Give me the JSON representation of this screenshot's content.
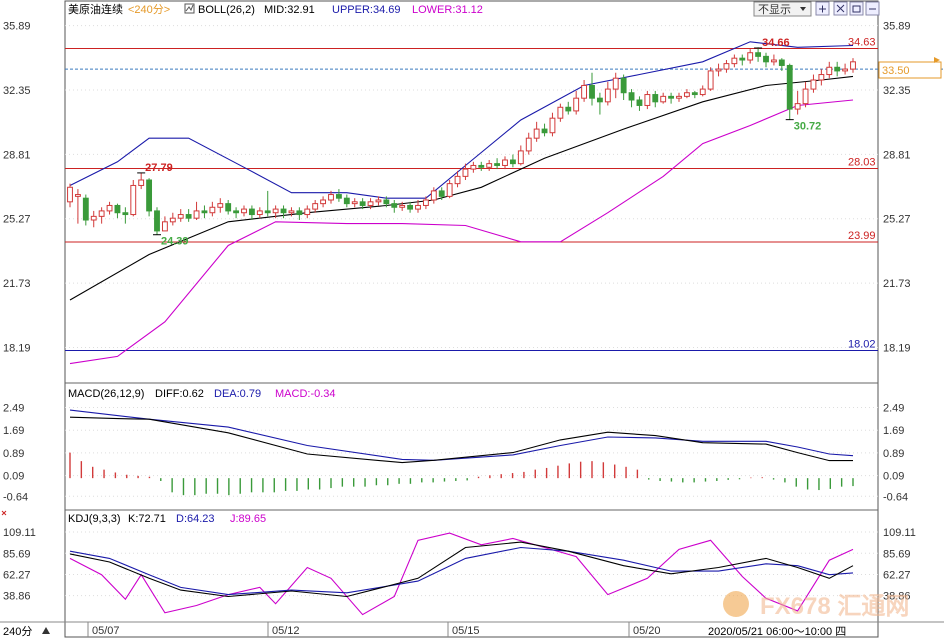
{
  "header": {
    "instrument": "美原油连续",
    "period": "<240分>",
    "indicator_name": "BOLL(26,2)",
    "mid_label": "MID:32.91",
    "upper_label": "UPPER:34.69",
    "lower_label": "LOWER:31.12",
    "display_toggle": "不显示",
    "colors": {
      "mid": "#000000",
      "upper": "#1a1aaa",
      "lower": "#cc00cc"
    }
  },
  "macd_header": {
    "name": "MACD(26,12,9)",
    "diff_label": "DIFF:0.62",
    "dea_label": "DEA:0.79",
    "macd_label": "MACD:-0.34"
  },
  "kdj_header": {
    "name": "KDJ(9,3,3)",
    "k_label": "K:72.71",
    "d_label": "D:64.23",
    "j_label": "J:89.65"
  },
  "footer": {
    "period_button": "240分",
    "date_labels": [
      "05/07",
      "05/12",
      "05/15",
      "05/20"
    ],
    "time_range": "2020/05/21 06:00～10:00 四",
    "watermark": "FX678 汇通网"
  },
  "chart_data": [
    {
      "type": "candlestick",
      "y_ticks": [
        "35.89",
        "32.35",
        "28.81",
        "25.27",
        "21.73",
        "18.19"
      ],
      "y_range": [
        16.4,
        36.2
      ],
      "price_tag": "33.50",
      "h_lines": [
        {
          "value": 34.63,
          "label": "34.63",
          "color": "#cc2222"
        },
        {
          "value": 28.03,
          "label": "28.03",
          "color": "#cc2222"
        },
        {
          "value": 23.99,
          "label": "23.99",
          "color": "#cc2222"
        },
        {
          "value": 18.02,
          "label": "18.02",
          "color": "#1a1aaa"
        }
      ],
      "annotations": [
        {
          "label": "27.79",
          "value": 27.79,
          "index": 9,
          "color": "#cc2222"
        },
        {
          "label": "24.39",
          "value": 24.39,
          "index": 11,
          "color": "#44aa44"
        },
        {
          "label": "34.66",
          "value": 34.66,
          "index": 87,
          "color": "#cc2222"
        },
        {
          "label": "30.72",
          "value": 30.72,
          "index": 91,
          "color": "#44aa44"
        }
      ],
      "candles": [
        [
          26.2,
          27.0,
          27.2,
          25.9
        ],
        [
          26.5,
          26.6,
          26.9,
          25.0
        ],
        [
          26.4,
          25.2,
          26.6,
          24.9
        ],
        [
          25.2,
          25.4,
          25.7,
          24.8
        ],
        [
          25.4,
          25.7,
          25.9,
          25.0
        ],
        [
          25.7,
          26.0,
          26.2,
          25.5
        ],
        [
          26.0,
          25.6,
          26.1,
          25.3
        ],
        [
          25.6,
          25.5,
          25.9,
          25.0
        ],
        [
          25.5,
          27.1,
          27.4,
          25.4
        ],
        [
          27.1,
          27.4,
          27.8,
          26.9
        ],
        [
          27.4,
          25.7,
          27.5,
          25.4
        ],
        [
          25.7,
          24.6,
          25.9,
          24.4
        ],
        [
          24.6,
          25.1,
          25.4,
          24.6
        ],
        [
          25.1,
          25.3,
          25.6,
          24.9
        ],
        [
          25.3,
          25.5,
          25.8,
          25.1
        ],
        [
          25.5,
          25.3,
          25.8,
          25.1
        ],
        [
          25.3,
          25.7,
          26.2,
          25.2
        ],
        [
          25.7,
          25.6,
          26.0,
          25.3
        ],
        [
          25.6,
          25.9,
          26.2,
          25.4
        ],
        [
          25.9,
          26.1,
          26.4,
          25.6
        ],
        [
          26.1,
          25.7,
          26.3,
          25.5
        ],
        [
          25.7,
          25.6,
          25.9,
          25.3
        ],
        [
          25.6,
          25.8,
          26.0,
          25.4
        ],
        [
          25.8,
          25.5,
          26.0,
          25.2
        ],
        [
          25.5,
          25.7,
          25.9,
          25.3
        ],
        [
          25.7,
          25.6,
          26.8,
          25.4
        ],
        [
          25.6,
          25.8,
          26.0,
          25.3
        ],
        [
          25.8,
          25.6,
          26.0,
          25.3
        ],
        [
          25.6,
          25.7,
          25.9,
          25.4
        ],
        [
          25.7,
          25.5,
          25.9,
          25.2
        ],
        [
          25.5,
          25.8,
          26.0,
          25.3
        ],
        [
          25.8,
          26.1,
          26.3,
          25.6
        ],
        [
          26.1,
          26.3,
          26.5,
          25.9
        ],
        [
          26.3,
          26.6,
          26.8,
          26.1
        ],
        [
          26.6,
          26.4,
          26.9,
          26.2
        ],
        [
          26.4,
          26.1,
          26.6,
          25.9
        ],
        [
          26.1,
          26.2,
          26.4,
          25.9
        ],
        [
          26.2,
          26.0,
          26.4,
          25.8
        ],
        [
          26.0,
          26.2,
          26.4,
          25.8
        ],
        [
          26.2,
          26.3,
          26.5,
          26.0
        ],
        [
          26.3,
          26.1,
          26.5,
          25.9
        ],
        [
          26.1,
          25.9,
          26.3,
          25.6
        ],
        [
          25.9,
          26.0,
          26.2,
          25.7
        ],
        [
          26.0,
          25.8,
          26.2,
          25.6
        ],
        [
          25.8,
          26.0,
          26.3,
          25.6
        ],
        [
          26.0,
          26.3,
          26.5,
          25.8
        ],
        [
          26.3,
          26.8,
          27.0,
          26.1
        ],
        [
          26.8,
          26.5,
          27.0,
          26.3
        ],
        [
          26.5,
          27.2,
          27.4,
          26.4
        ],
        [
          27.2,
          27.6,
          27.9,
          27.0
        ],
        [
          27.6,
          28.0,
          28.3,
          27.4
        ],
        [
          28.0,
          28.2,
          28.4,
          27.8
        ],
        [
          28.2,
          28.1,
          28.4,
          27.9
        ],
        [
          28.1,
          28.3,
          28.5,
          27.9
        ],
        [
          28.3,
          28.2,
          28.6,
          28.0
        ],
        [
          28.2,
          28.5,
          28.7,
          28.0
        ],
        [
          28.5,
          28.3,
          28.8,
          28.1
        ],
        [
          28.3,
          29.0,
          29.3,
          28.2
        ],
        [
          29.0,
          29.7,
          30.0,
          28.8
        ],
        [
          29.7,
          30.2,
          30.6,
          29.5
        ],
        [
          30.2,
          30.0,
          30.5,
          29.8
        ],
        [
          30.0,
          30.8,
          31.1,
          29.8
        ],
        [
          30.8,
          31.4,
          31.6,
          30.6
        ],
        [
          31.4,
          31.2,
          31.7,
          31.0
        ],
        [
          31.2,
          31.9,
          32.3,
          31.0
        ],
        [
          31.9,
          32.6,
          32.9,
          31.7
        ],
        [
          32.6,
          31.9,
          33.3,
          31.5
        ],
        [
          31.9,
          31.7,
          32.2,
          31.0
        ],
        [
          31.7,
          32.4,
          32.8,
          31.5
        ],
        [
          32.4,
          33.0,
          33.3,
          31.9
        ],
        [
          33.0,
          32.2,
          33.2,
          31.8
        ],
        [
          32.2,
          31.8,
          32.4,
          31.4
        ],
        [
          31.8,
          31.5,
          32.0,
          31.2
        ],
        [
          31.5,
          32.1,
          32.3,
          31.3
        ],
        [
          32.1,
          31.7,
          32.3,
          31.4
        ],
        [
          31.7,
          32.0,
          32.2,
          31.6
        ],
        [
          32.0,
          31.9,
          32.2,
          31.6
        ],
        [
          31.9,
          32.0,
          32.2,
          31.7
        ],
        [
          32.0,
          32.2,
          32.4,
          31.9
        ],
        [
          32.2,
          32.1,
          32.3,
          31.9
        ],
        [
          32.1,
          32.4,
          32.6,
          32.0
        ],
        [
          32.4,
          33.4,
          33.6,
          32.3
        ],
        [
          33.4,
          33.5,
          33.8,
          33.1
        ],
        [
          33.5,
          33.8,
          34.0,
          33.3
        ],
        [
          33.8,
          34.1,
          34.3,
          33.6
        ],
        [
          34.1,
          34.0,
          34.3,
          33.7
        ],
        [
          34.0,
          34.4,
          34.6,
          33.8
        ],
        [
          34.4,
          34.2,
          34.7,
          33.9
        ],
        [
          34.2,
          33.9,
          34.4,
          33.6
        ],
        [
          33.9,
          34.0,
          34.3,
          33.7
        ],
        [
          34.0,
          33.7,
          34.1,
          33.4
        ],
        [
          33.7,
          31.3,
          33.8,
          30.7
        ],
        [
          31.3,
          31.6,
          32.3,
          31.0
        ],
        [
          31.6,
          32.4,
          32.8,
          31.4
        ],
        [
          32.4,
          32.9,
          33.2,
          32.2
        ],
        [
          32.9,
          33.2,
          33.5,
          32.6
        ],
        [
          33.2,
          33.6,
          33.9,
          33.0
        ],
        [
          33.6,
          33.4,
          33.9,
          33.1
        ],
        [
          33.4,
          33.5,
          33.8,
          33.2
        ],
        [
          33.5,
          33.9,
          34.1,
          33.3
        ]
      ],
      "boll_mid": [
        [
          0,
          20.8
        ],
        [
          10,
          23.3
        ],
        [
          20,
          25.1
        ],
        [
          30,
          25.6
        ],
        [
          40,
          26.0
        ],
        [
          46,
          26.3
        ],
        [
          52,
          27.0
        ],
        [
          60,
          28.6
        ],
        [
          70,
          30.2
        ],
        [
          80,
          31.7
        ],
        [
          88,
          32.6
        ],
        [
          95,
          32.9
        ],
        [
          99,
          33.1
        ]
      ],
      "boll_upper": [
        [
          0,
          27.1
        ],
        [
          6,
          28.4
        ],
        [
          10,
          29.7
        ],
        [
          15,
          29.7
        ],
        [
          22,
          28.1
        ],
        [
          28,
          26.7
        ],
        [
          35,
          26.7
        ],
        [
          40,
          26.4
        ],
        [
          45,
          26.4
        ],
        [
          50,
          28.2
        ],
        [
          57,
          30.7
        ],
        [
          65,
          32.6
        ],
        [
          72,
          33.2
        ],
        [
          80,
          33.9
        ],
        [
          86,
          35.0
        ],
        [
          92,
          34.7
        ],
        [
          99,
          34.8
        ]
      ],
      "boll_lower": [
        [
          0,
          17.3
        ],
        [
          6,
          17.7
        ],
        [
          12,
          19.6
        ],
        [
          20,
          23.8
        ],
        [
          26,
          25.1
        ],
        [
          35,
          25.0
        ],
        [
          42,
          25.0
        ],
        [
          50,
          24.9
        ],
        [
          57,
          24.0
        ],
        [
          62,
          24.0
        ],
        [
          68,
          25.6
        ],
        [
          75,
          27.6
        ],
        [
          80,
          29.4
        ],
        [
          86,
          30.4
        ],
        [
          92,
          31.5
        ],
        [
          99,
          31.8
        ]
      ]
    },
    {
      "type": "line",
      "name": "MACD",
      "y_ticks": [
        "2.49",
        "1.69",
        "0.89",
        "0.09",
        "-0.64"
      ],
      "y_range": [
        -0.7,
        2.65
      ],
      "diff": [
        [
          0,
          2.15
        ],
        [
          6,
          2.1
        ],
        [
          10,
          2.08
        ],
        [
          20,
          1.6
        ],
        [
          30,
          0.85
        ],
        [
          42,
          0.55
        ],
        [
          46,
          0.63
        ],
        [
          56,
          0.9
        ],
        [
          62,
          1.35
        ],
        [
          68,
          1.62
        ],
        [
          74,
          1.5
        ],
        [
          80,
          1.25
        ],
        [
          88,
          1.2
        ],
        [
          92,
          0.9
        ],
        [
          96,
          0.62
        ],
        [
          99,
          0.62
        ]
      ],
      "dea": [
        [
          0,
          2.4
        ],
        [
          10,
          2.08
        ],
        [
          20,
          1.8
        ],
        [
          30,
          1.15
        ],
        [
          42,
          0.66
        ],
        [
          46,
          0.63
        ],
        [
          56,
          0.82
        ],
        [
          62,
          1.15
        ],
        [
          68,
          1.45
        ],
        [
          74,
          1.42
        ],
        [
          80,
          1.3
        ],
        [
          88,
          1.3
        ],
        [
          92,
          1.1
        ],
        [
          96,
          0.85
        ],
        [
          99,
          0.79
        ]
      ],
      "macd_bars": [
        0.9,
        0.6,
        0.4,
        0.3,
        0.2,
        0.12,
        0.08,
        0.05,
        -0.1,
        -0.5,
        -0.6,
        -0.6,
        -0.55,
        -0.55,
        -0.6,
        -0.55,
        -0.5,
        -0.5,
        -0.5,
        -0.45,
        -0.45,
        -0.4,
        -0.4,
        -0.35,
        -0.3,
        -0.3,
        -0.3,
        -0.25,
        -0.25,
        -0.2,
        -0.2,
        -0.15,
        -0.15,
        -0.12,
        -0.1,
        -0.08,
        0.05,
        0.1,
        0.14,
        0.18,
        0.22,
        0.3,
        0.36,
        0.44,
        0.52,
        0.58,
        0.6,
        0.56,
        0.48,
        0.4,
        0.3,
        -0.05,
        -0.1,
        -0.12,
        -0.15,
        -0.15,
        -0.12,
        -0.1,
        -0.06,
        -0.04,
        0.02,
        0.03,
        -0.05,
        -0.15,
        -0.3,
        -0.4,
        -0.42,
        -0.38,
        -0.3,
        -0.28
      ],
      "macd_bar_start_index": 30
    },
    {
      "type": "line",
      "name": "KDJ",
      "y_ticks": [
        "109.11",
        "85.69",
        "62.27",
        "38.86"
      ],
      "y_range": [
        12,
        118
      ],
      "k": [
        [
          0,
          85
        ],
        [
          5,
          76
        ],
        [
          10,
          58
        ],
        [
          14,
          45
        ],
        [
          20,
          38
        ],
        [
          28,
          44
        ],
        [
          35,
          38
        ],
        [
          44,
          58
        ],
        [
          50,
          92
        ],
        [
          57,
          98
        ],
        [
          63,
          88
        ],
        [
          70,
          72
        ],
        [
          76,
          63
        ],
        [
          82,
          70
        ],
        [
          88,
          80
        ],
        [
          92,
          70
        ],
        [
          96,
          58
        ],
        [
          99,
          72
        ]
      ],
      "d": [
        [
          0,
          88
        ],
        [
          5,
          80
        ],
        [
          10,
          62
        ],
        [
          14,
          48
        ],
        [
          20,
          40
        ],
        [
          28,
          45
        ],
        [
          35,
          42
        ],
        [
          44,
          55
        ],
        [
          50,
          80
        ],
        [
          57,
          92
        ],
        [
          63,
          88
        ],
        [
          70,
          78
        ],
        [
          76,
          66
        ],
        [
          82,
          66
        ],
        [
          88,
          74
        ],
        [
          92,
          72
        ],
        [
          96,
          62
        ],
        [
          99,
          64
        ]
      ],
      "j": [
        [
          0,
          80
        ],
        [
          4,
          62
        ],
        [
          7,
          35
        ],
        [
          9,
          62
        ],
        [
          12,
          20
        ],
        [
          16,
          28
        ],
        [
          20,
          40
        ],
        [
          24,
          48
        ],
        [
          26,
          30
        ],
        [
          30,
          70
        ],
        [
          33,
          58
        ],
        [
          37,
          18
        ],
        [
          41,
          38
        ],
        [
          44,
          100
        ],
        [
          48,
          108
        ],
        [
          52,
          95
        ],
        [
          56,
          102
        ],
        [
          60,
          92
        ],
        [
          64,
          82
        ],
        [
          68,
          40
        ],
        [
          73,
          58
        ],
        [
          77,
          90
        ],
        [
          81,
          100
        ],
        [
          85,
          60
        ],
        [
          88,
          36
        ],
        [
          92,
          22
        ],
        [
          96,
          78
        ],
        [
          99,
          90
        ]
      ]
    }
  ]
}
